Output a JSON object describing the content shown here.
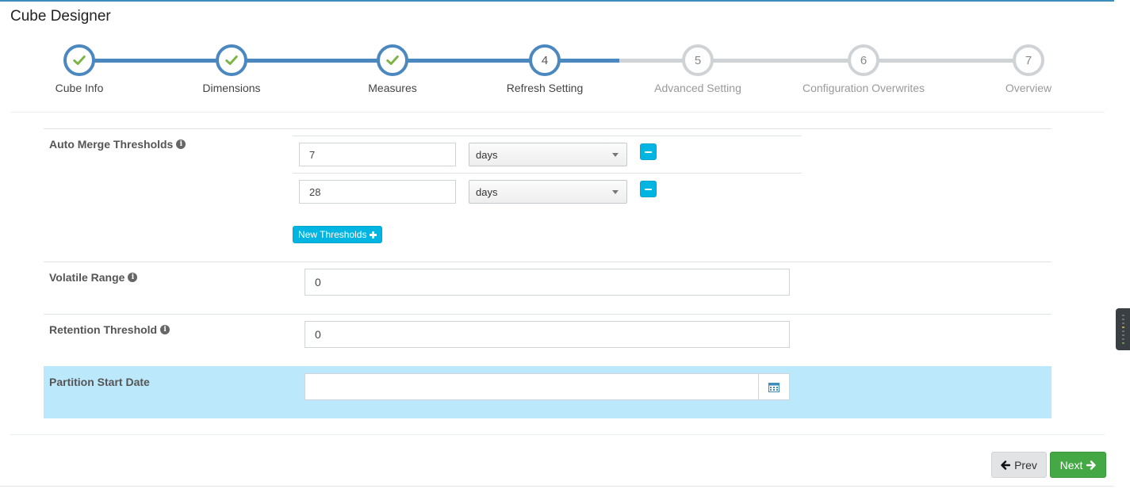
{
  "page": {
    "title": "Cube Designer"
  },
  "wizard": {
    "steps": [
      {
        "number": "1",
        "label": "Cube Info",
        "state": "done"
      },
      {
        "number": "2",
        "label": "Dimensions",
        "state": "done"
      },
      {
        "number": "3",
        "label": "Measures",
        "state": "done"
      },
      {
        "number": "4",
        "label": "Refresh Setting",
        "state": "active"
      },
      {
        "number": "5",
        "label": "Advanced Setting",
        "state": "todo"
      },
      {
        "number": "6",
        "label": "Configuration Overwrites",
        "state": "todo"
      },
      {
        "number": "7",
        "label": "Overview",
        "state": "todo"
      }
    ],
    "colors": {
      "done": "#4a88bf",
      "todo": "#d0d3d6",
      "check": "#7cb342"
    }
  },
  "form": {
    "auto_merge": {
      "label": "Auto Merge Thresholds",
      "thresholds": [
        {
          "value": "7",
          "unit": "days"
        },
        {
          "value": "28",
          "unit": "days"
        }
      ],
      "new_button": "New Thresholds"
    },
    "volatile_range": {
      "label": "Volatile Range",
      "value": "0"
    },
    "retention_threshold": {
      "label": "Retention Threshold",
      "value": "0"
    },
    "partition_start_date": {
      "label": "Partition Start Date",
      "value": ""
    }
  },
  "footer": {
    "prev_label": "Prev",
    "next_label": "Next"
  },
  "icons": {
    "info": "info-icon",
    "calendar": "calendar-icon",
    "check": "check-icon",
    "prev": "arrow-left-icon",
    "next": "arrow-right-icon"
  }
}
